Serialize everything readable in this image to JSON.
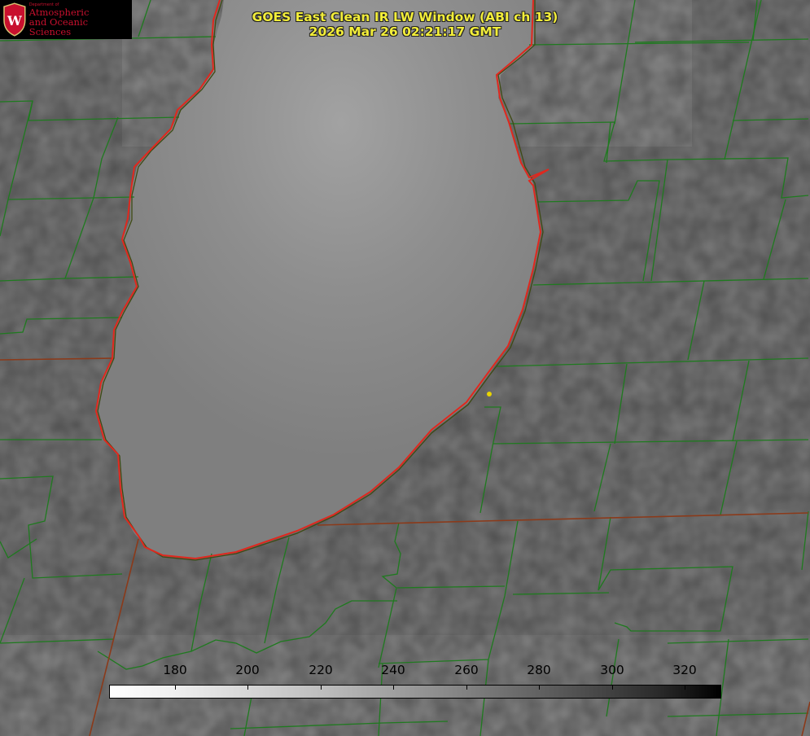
{
  "header": {
    "title_line1": "GOES East Clean IR LW Window (ABI ch 13)",
    "title_line2": "2026 Mar 26 02:21:17 GMT"
  },
  "logo": {
    "dept": "Department of",
    "line1": "Atmospheric",
    "line2": "and Oceanic Sciences",
    "seal_letter": "W"
  },
  "colorbar": {
    "ticks": [
      "180",
      "200",
      "220",
      "240",
      "260",
      "280",
      "300",
      "320"
    ],
    "min": 162,
    "max": 330
  },
  "colors": {
    "title": "#f3ee3a",
    "shoreline": "#e0281e",
    "county_lines": "#1f7a1f",
    "state_lines": "#8b3a1a",
    "marker": "#e8d400",
    "logo_red": "#c8102e"
  }
}
